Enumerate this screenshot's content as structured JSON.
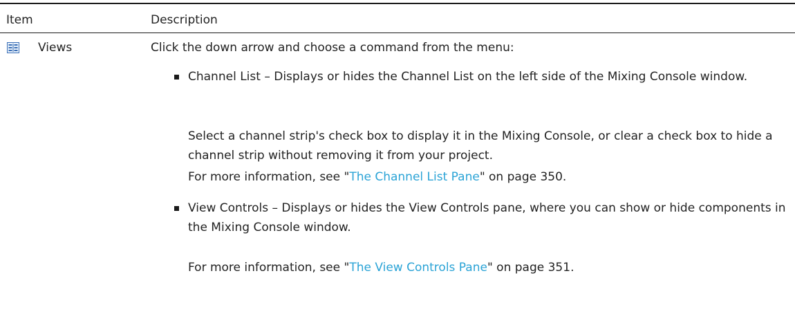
{
  "table": {
    "header": {
      "item": "Item",
      "description": "Description"
    },
    "row": {
      "icon": "views-grid-icon",
      "item": "Views",
      "intro": "Click the down arrow and choose a command from the menu:",
      "bullets": [
        {
          "term": "Channel List",
          "text": " – Displays or hides the Channel List on the left side of the Mixing Console window.",
          "para1": "Select a channel strip's check box to display it in the Mixing Console, or clear a check box to hide a channel strip without removing it from your project.",
          "see_prefix": "For more information, see \"",
          "see_link": "The Channel List Pane",
          "see_suffix": "\" on page 350."
        },
        {
          "term": "View Controls",
          "text": " – Displays or hides the View Controls pane, where you can show or hide components in the Mixing Console window.",
          "see_prefix": "For more information, see \"",
          "see_link": "The View Controls Pane",
          "see_suffix": "\" on page 351."
        }
      ]
    }
  },
  "colors": {
    "link": "#2aa3d6",
    "icon": "#3b6fb6"
  }
}
